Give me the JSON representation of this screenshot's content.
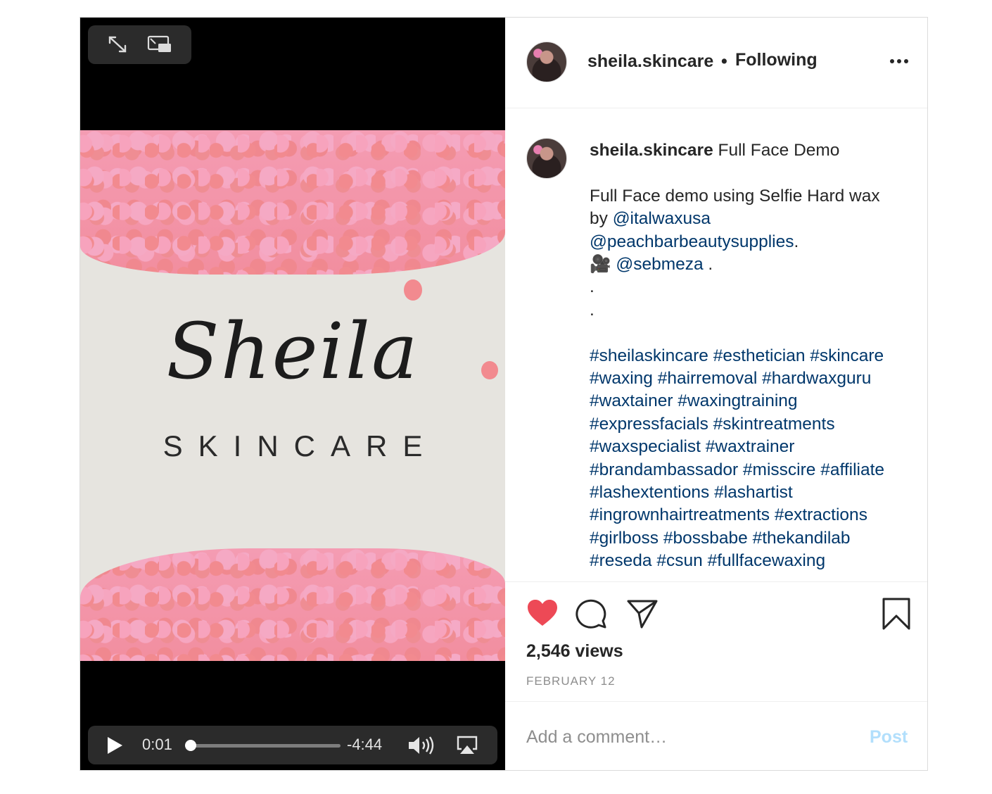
{
  "video": {
    "overlay_brand_script": "Sheila",
    "overlay_brand_sub": "SKINCARE",
    "controls": {
      "current_time": "0:01",
      "remaining_time": "-4:44",
      "progress_fraction": 0.004
    },
    "icons": [
      "expand-icon",
      "picture-in-picture-icon",
      "play-icon",
      "volume-icon",
      "airplay-icon"
    ]
  },
  "header": {
    "username": "sheila.skincare",
    "separator": "•",
    "follow_status": "Following",
    "more_icon": "more-options-icon"
  },
  "caption": {
    "username": "sheila.skincare",
    "title": "Full Face Demo",
    "line1": "Full Face demo using Selfie Hard wax",
    "line2_prefix": "by ",
    "mention1": "@italwaxusa",
    "mention2": "@peachbarbeautysupplies",
    "mention2_suffix": ".",
    "camera_emoji": "🎥",
    "mention3": "@sebmeza",
    "mention3_suffix": " .",
    "dot1": ".",
    "dot2": ".",
    "hashtag_lines": [
      [
        "#sheilaskincare",
        "#esthetician",
        "#skincare"
      ],
      [
        "#waxing",
        "#hairremoval",
        "#hardwaxguru"
      ],
      [
        "#waxtainer",
        "#waxingtraining"
      ],
      [
        "#expressfacials",
        "#skintreatments"
      ],
      [
        "#waxspecialist",
        "#waxtrainer"
      ],
      [
        "#brandambassador",
        "#misscire",
        "#affiliate"
      ],
      [
        "#lashextentions",
        "#lashartist"
      ],
      [
        "#ingrownhairtreatments",
        "#extractions"
      ],
      [
        "#girlboss",
        "#bossbabe",
        "#thekandilab"
      ],
      [
        "#reseda",
        "#csun",
        "#fullfacewaxing"
      ]
    ]
  },
  "actions": {
    "liked": true,
    "like_color": "#ed4956",
    "views": "2,546 views",
    "date": "FEBRUARY 12"
  },
  "comment": {
    "placeholder": "Add a comment…",
    "post_label": "Post",
    "post_color": "#b2dffc"
  }
}
